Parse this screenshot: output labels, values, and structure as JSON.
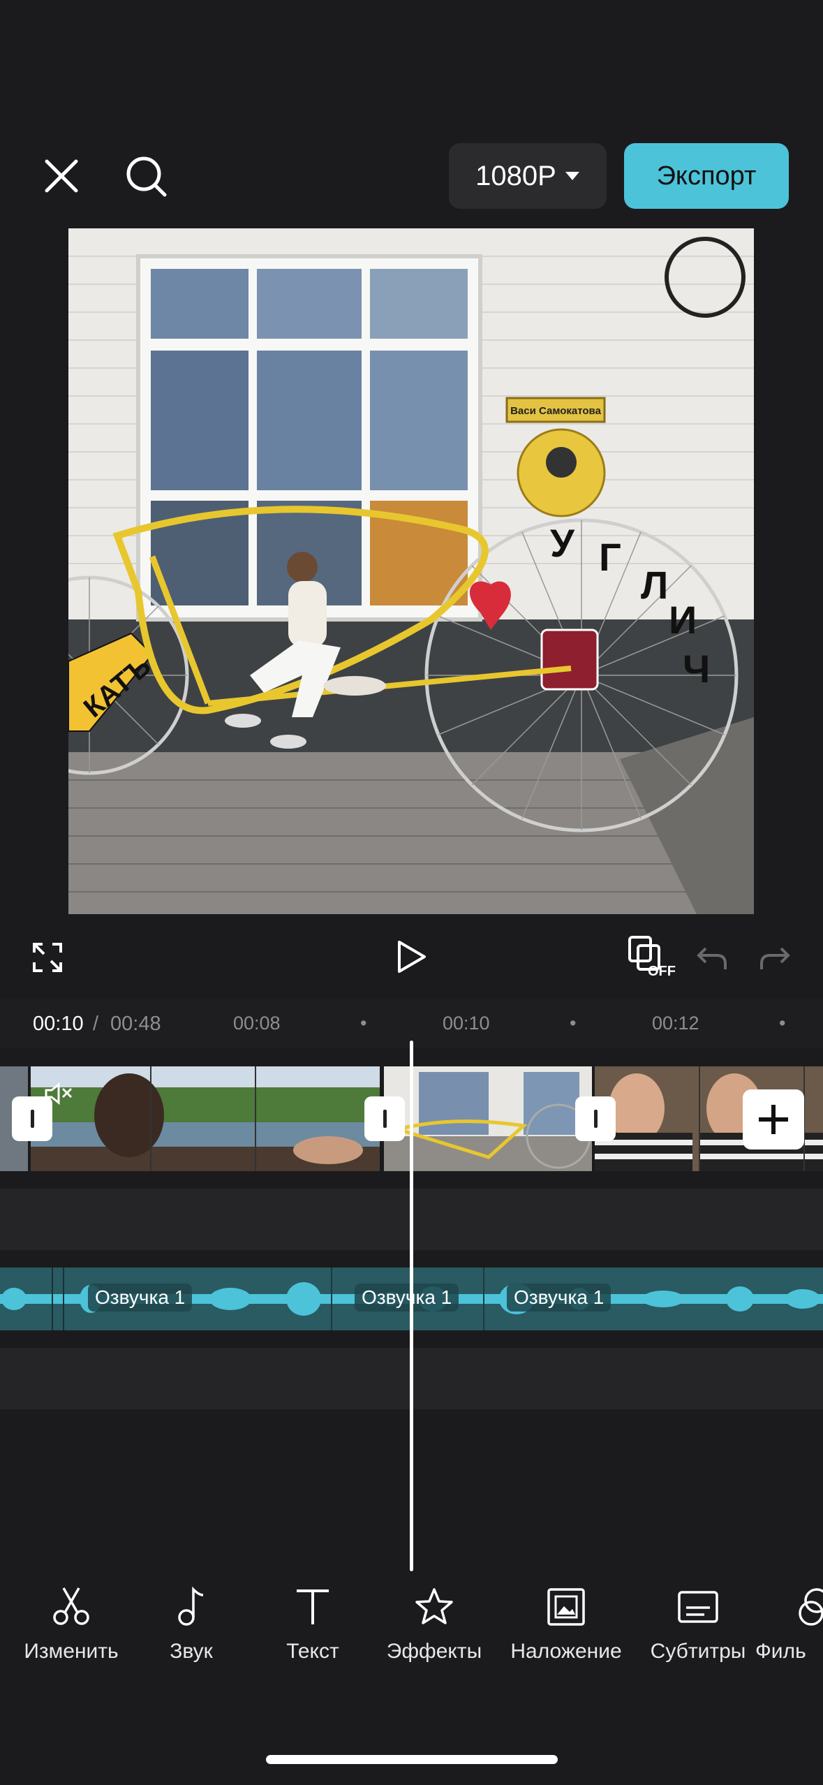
{
  "header": {
    "resolution_label": "1080P",
    "export_label": "Экспорт"
  },
  "preview": {
    "sign_text": "Васи Самокатова",
    "wheel_text": [
      "У",
      "Г",
      "Л",
      "И",
      "Ч"
    ],
    "left_text": "КАТЪ"
  },
  "controls": {
    "off_label": "OFF"
  },
  "timeline": {
    "current_time": "00:10",
    "separator": "/",
    "total_time": "00:48",
    "ticks": [
      "00:08",
      "00:10",
      "00:12"
    ],
    "audio_segments": [
      "Озвучка 1",
      "Озвучка 1",
      "Озвучка 1"
    ]
  },
  "toolbar": {
    "items": [
      {
        "label": "Изменить",
        "icon": "scissors-icon"
      },
      {
        "label": "Звук",
        "icon": "music-note-icon"
      },
      {
        "label": "Текст",
        "icon": "text-icon"
      },
      {
        "label": "Эффекты",
        "icon": "star-effects-icon"
      },
      {
        "label": "Наложение",
        "icon": "overlay-image-icon"
      },
      {
        "label": "Субтитры",
        "icon": "subtitles-icon"
      },
      {
        "label": "Филь",
        "icon": "filters-icon"
      }
    ]
  },
  "colors": {
    "accent": "#4cc3d9",
    "audio_track": "#2a5a62",
    "background": "#1b1b1d"
  }
}
